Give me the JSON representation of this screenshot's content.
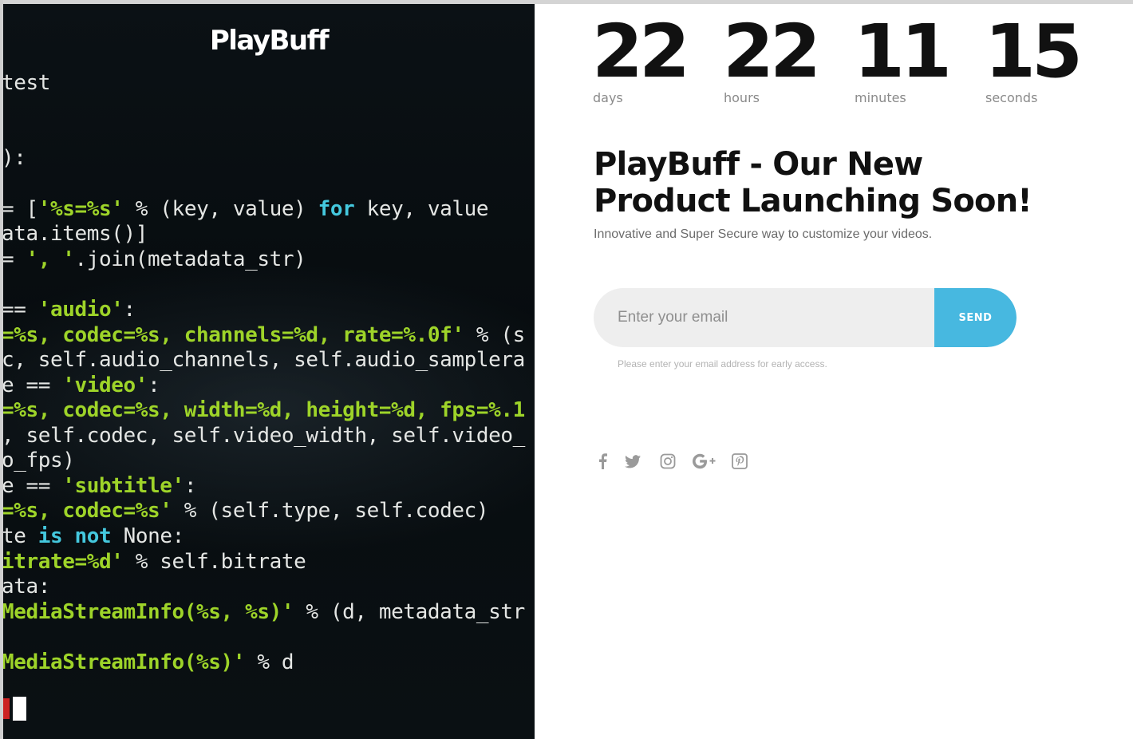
{
  "brand": {
    "name": "PlayBuff"
  },
  "terminal": {
    "lines": [
      [
        {
          "t": "test"
        }
      ],
      [
        {
          "t": "):"
        }
      ],
      [
        {
          "t": "= ["
        },
        {
          "t": "'%s=%s'",
          "c": "s"
        },
        {
          "t": " % (key, value) "
        },
        {
          "t": "for",
          "c": "k"
        },
        {
          "t": " key, value"
        }
      ],
      [
        {
          "t": "ata.items()]"
        }
      ],
      [
        {
          "t": "= "
        },
        {
          "t": "', '",
          "c": "s"
        },
        {
          "t": ".join(metadata_str)"
        }
      ],
      [
        {
          "t": "== "
        },
        {
          "t": "'audio'",
          "c": "s"
        },
        {
          "t": ":"
        }
      ],
      [
        {
          "t": "=%s, codec=%s, channels=%d, rate=%.0f'",
          "c": "s"
        },
        {
          "t": " % (s"
        }
      ],
      [
        {
          "t": "c, self.audio_channels, self.audio_samplera"
        }
      ],
      [
        {
          "t": "e == "
        },
        {
          "t": "'video'",
          "c": "s"
        },
        {
          "t": ":"
        }
      ],
      [
        {
          "t": "=%s, codec=%s, width=%d, height=%d, fps=%.1",
          "c": "s"
        }
      ],
      [
        {
          "t": ", self.codec, self.video_width, self.video_"
        }
      ],
      [
        {
          "t": "o_fps)"
        }
      ],
      [
        {
          "t": "e == "
        },
        {
          "t": "'subtitle'",
          "c": "s"
        },
        {
          "t": ":"
        }
      ],
      [
        {
          "t": "=%s, codec=%s'",
          "c": "s"
        },
        {
          "t": " % (self.type, self.codec)"
        }
      ],
      [
        {
          "t": "te "
        },
        {
          "t": "is",
          "c": "k"
        },
        {
          "t": " "
        },
        {
          "t": "not",
          "c": "k"
        },
        {
          "t": " None:"
        }
      ],
      [
        {
          "t": "itrate=%d'",
          "c": "s"
        },
        {
          "t": " % self.bitrate"
        }
      ],
      [
        {
          "t": "ata:"
        }
      ],
      [
        {
          "t": "MediaStreamInfo(%s, %s)'",
          "c": "s"
        },
        {
          "t": " % (d, metadata_str"
        }
      ],
      [
        {
          "t": "MediaStreamInfo(%s)'",
          "c": "s"
        },
        {
          "t": " % d"
        }
      ]
    ]
  },
  "countdown": [
    {
      "value": "22",
      "label": "days"
    },
    {
      "value": "22",
      "label": "hours"
    },
    {
      "value": "11",
      "label": "minutes"
    },
    {
      "value": "15",
      "label": "seconds"
    }
  ],
  "headline": {
    "line1": "PlayBuff - Our New",
    "line2": "Product Launching Soon!"
  },
  "subtext": "Innovative and Super Secure way to customize your videos.",
  "subscribe": {
    "placeholder": "Enter your email",
    "button_label": "SEND",
    "hint": "Please enter your email address for early access."
  },
  "social": [
    "facebook-icon",
    "twitter-icon",
    "instagram-icon",
    "google-plus-icon",
    "pinterest-icon"
  ],
  "colors": {
    "accent": "#47b8e0",
    "code_string": "#9ed429",
    "code_keyword": "#44c8de"
  }
}
